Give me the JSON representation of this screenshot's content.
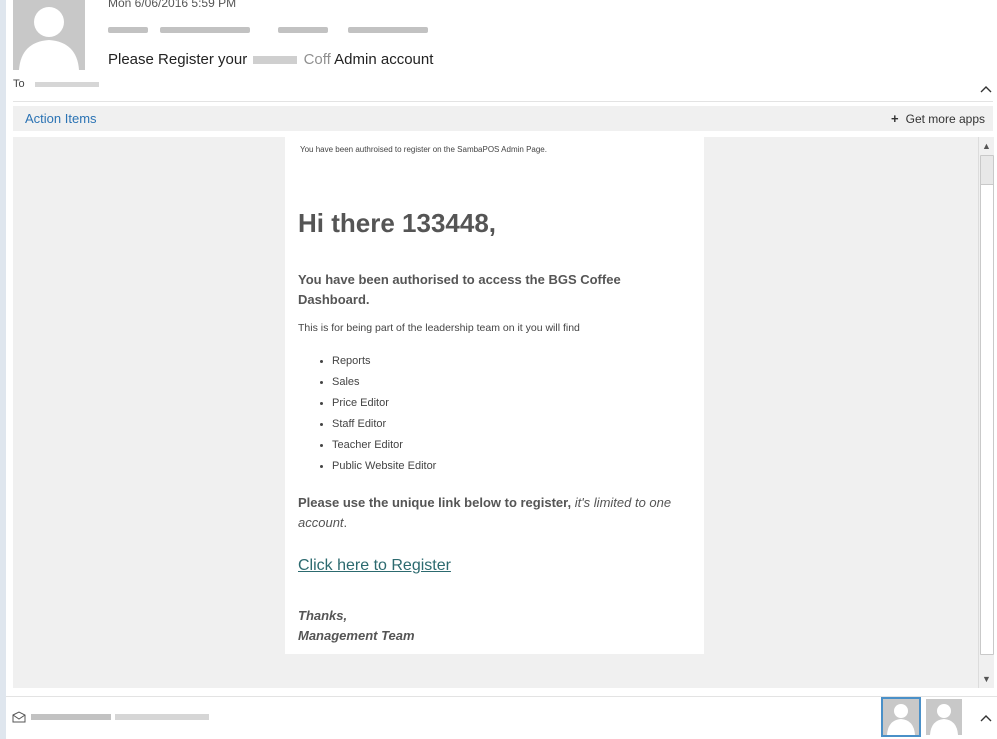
{
  "header": {
    "date": "Mon 6/06/2016 5:59 PM",
    "subject_start": "Please Register your",
    "subject_mid": "Coff",
    "subject_end": "Admin account",
    "to_label": "To"
  },
  "action_bar": {
    "action_items": "Action Items",
    "get_more_plus": "+",
    "get_more_label": "Get more apps"
  },
  "email": {
    "preheader": "You have been authroised to register on the SambaPOS Admin Page.",
    "greeting": "Hi there 133448,",
    "authorised": "You have been authorised to access the BGS Coffee Dashboard.",
    "intro": "This is for being part of the leadership team on it you will find",
    "features": [
      "Reports",
      "Sales",
      "Price Editor",
      "Staff Editor",
      "Teacher Editor",
      "Public Website Editor"
    ],
    "use_link_bold": "Please use the unique link below to register,",
    "use_link_italic": "it's limited to one account",
    "use_link_end": ".",
    "register_link": "Click here to Register",
    "thanks": "Thanks,",
    "team": "Management Team"
  },
  "scrollbar": {
    "up": "▲",
    "down": "▼"
  },
  "colors": {
    "accent": "#2b73b4",
    "link": "#2c6a6f",
    "panel": "#f0f0f0"
  }
}
